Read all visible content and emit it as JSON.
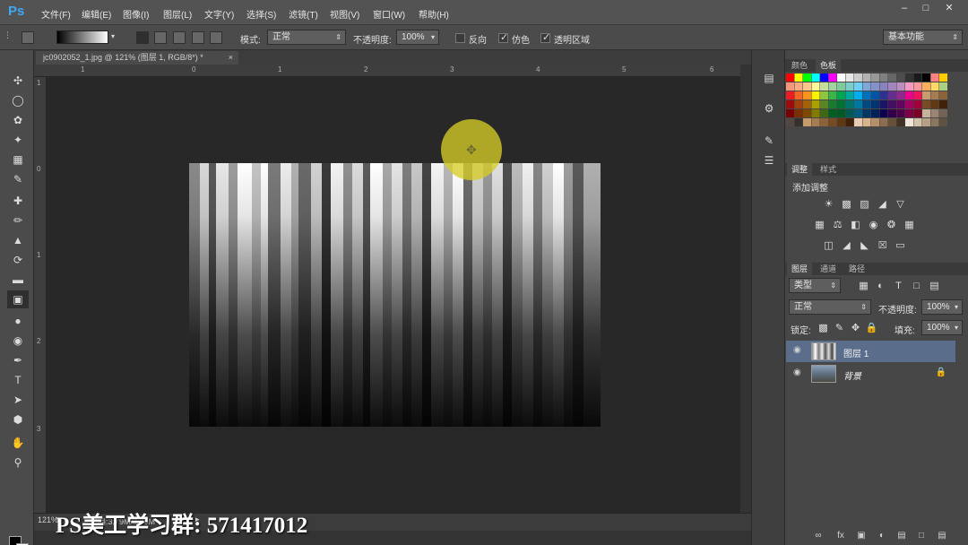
{
  "app": {
    "logo": "Ps",
    "menu": [
      "文件(F)",
      "编辑(E)",
      "图像(I)",
      "图层(L)",
      "文字(Y)",
      "选择(S)",
      "滤镜(T)",
      "视图(V)",
      "窗口(W)",
      "帮助(H)"
    ],
    "window_controls": [
      "minimize",
      "restore",
      "close"
    ]
  },
  "options": {
    "mode_label": "模式:",
    "mode_value": "正常",
    "opacity_label": "不透明度:",
    "opacity_value": "100%",
    "reverse_label": "反向",
    "dither_label": "仿色",
    "transparency_label": "透明区域",
    "reverse_checked": false,
    "dither_checked": true,
    "transparency_checked": true,
    "workspace": "基本功能"
  },
  "document": {
    "tab_title": "jc0902052_1.jpg @ 121% (图层 1, RGB/8*) *",
    "zoom": "121%",
    "status_text": "文档:3.79M/3.79M"
  },
  "rulers": {
    "h_ticks": [
      "1",
      "0",
      "1",
      "2",
      "3",
      "4",
      "5",
      "6"
    ],
    "v_ticks": [
      "1",
      "0",
      "1",
      "2",
      "3"
    ]
  },
  "watermark": "PS美工学习群:  571417012",
  "panels": {
    "color_tabs": [
      "颜色",
      "色板"
    ],
    "adjust_tabs": [
      "调整",
      "样式"
    ],
    "adjust_title": "添加调整",
    "layers_tabs": [
      "图层",
      "通道",
      "路径"
    ],
    "kind_filter": "类型",
    "blend_mode": "正常",
    "opacity_label": "不透明度:",
    "opacity_value": "100%",
    "lock_label": "锁定:",
    "fill_label": "填充:",
    "fill_value": "100%",
    "layers": [
      {
        "name": "图层 1",
        "selected": true,
        "locked": false
      },
      {
        "name": "背景",
        "selected": false,
        "locked": true
      }
    ]
  },
  "colors": {
    "menubar": "#535353",
    "canvas_bg": "#282828",
    "selected_layer": "#5a6e8c",
    "cursor_ring": "#d6cd28",
    "ps_blue": "#3da8f5"
  },
  "icons": [
    "move-icon",
    "marquee-icon",
    "lasso-icon",
    "magic-wand-icon",
    "crop-icon",
    "eyedropper-icon",
    "healing-icon",
    "brush-icon",
    "stamp-icon",
    "history-brush-icon",
    "eraser-icon",
    "gradient-icon",
    "blur-icon",
    "dodge-icon",
    "pen-icon",
    "type-icon",
    "path-select-icon",
    "shape-icon",
    "hand-icon",
    "zoom-icon"
  ]
}
